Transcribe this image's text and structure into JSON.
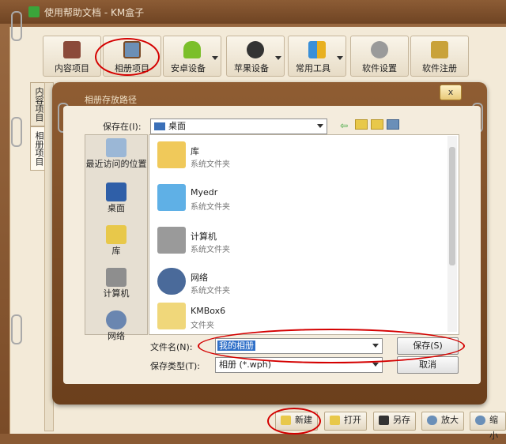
{
  "window": {
    "title": "使用帮助文档 - KM盒子"
  },
  "toolbar": {
    "buttons": [
      {
        "label": "内容项目",
        "icon": "book-icon"
      },
      {
        "label": "相册项目",
        "icon": "photo-album-icon"
      },
      {
        "label": "安卓设备",
        "icon": "android-icon"
      },
      {
        "label": "苹果设备",
        "icon": "apple-icon"
      },
      {
        "label": "常用工具",
        "icon": "tools-icon"
      },
      {
        "label": "软件设置",
        "icon": "gear-icon"
      },
      {
        "label": "软件注册",
        "icon": "key-icon"
      }
    ]
  },
  "side_tabs": {
    "content": "内容项目",
    "album": "相册项目"
  },
  "bottom_bar": {
    "new": "新建",
    "open": "打开",
    "save_as": "另存",
    "zoom_in": "放大",
    "zoom_out": "缩小"
  },
  "dialog": {
    "title": "相册存放路径",
    "close": "x",
    "save_in_label": "保存在(I):",
    "save_in_value": "桌面",
    "places": [
      "最近访问的位置",
      "桌面",
      "库",
      "计算机",
      "网络"
    ],
    "files": [
      {
        "name": "库",
        "type": "系统文件夹",
        "icon": "library-folder-icon"
      },
      {
        "name": "Myedr",
        "type": "系统文件夹",
        "icon": "user-folder-icon"
      },
      {
        "name": "计算机",
        "type": "系统文件夹",
        "icon": "computer-icon"
      },
      {
        "name": "网络",
        "type": "系统文件夹",
        "icon": "network-icon"
      },
      {
        "name": "KMBox6",
        "type": "文件夹",
        "icon": "folder-icon"
      }
    ],
    "filename_label": "文件名(N):",
    "filename_value": "我的相册",
    "filetype_label": "保存类型(T):",
    "filetype_value": "相册 (*.wph)",
    "save_button": "保存(S)",
    "cancel_button": "取消"
  },
  "colors": {
    "highlight_oval": "#d40000",
    "wood": "#7a4b27",
    "page": "#f3ead8"
  }
}
